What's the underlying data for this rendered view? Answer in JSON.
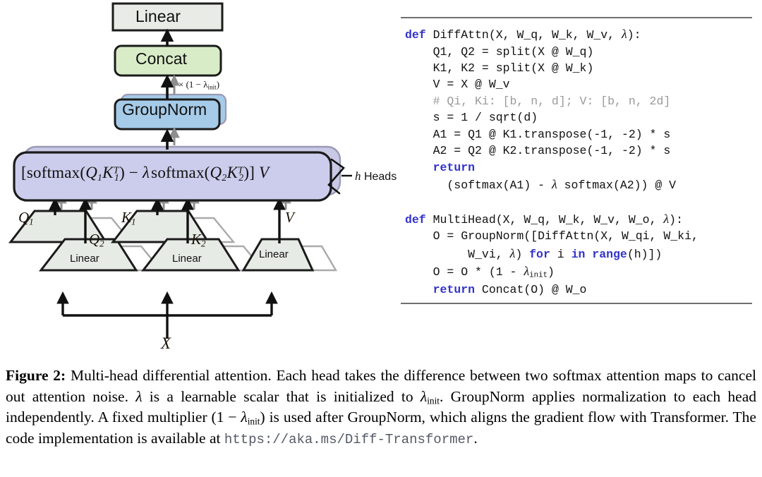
{
  "figure": {
    "id": "Figure 2",
    "diagram": {
      "boxes": {
        "linear_top": "Linear",
        "concat": "Concat",
        "groupnorm": "GroupNorm",
        "trapezoid_q": "Linear",
        "trapezoid_k": "Linear",
        "trapezoid_v": "Linear"
      },
      "annotations": {
        "multiplier": "× (1 − λ",
        "multiplier_sub": "init",
        "multiplier_close": ")",
        "heads": "Heads",
        "heads_var": "h",
        "input": "X"
      },
      "tensor_labels": {
        "q1_base": "Q",
        "q1_sub": "1",
        "q2_base": "Q",
        "q2_sub": "2",
        "k1_base": "K",
        "k1_sub": "1",
        "k2_base": "K",
        "k2_sub": "2",
        "v": "V"
      },
      "formula": {
        "open_bracket": "[",
        "softmax1": "softmax(",
        "q1": "Q",
        "q1sub": "1",
        "k1": "K",
        "k1sub": "1",
        "k1sup": "T",
        "close1": ")",
        "minus": " − ",
        "lambda": "λ",
        "softmax2": "softmax(",
        "q2": "Q",
        "q2sub": "2",
        "k2": "K",
        "k2sub": "2",
        "k2sup": "T",
        "close2": ")",
        "close_bracket": "]",
        "v": "V"
      },
      "colors": {
        "linear_fill": "#e8ebe6",
        "concat_fill": "#d9ecc8",
        "groupnorm_fill": "#a6cbe8",
        "attention_fill": "#ccccec",
        "trapezoid_fill": "#e7ebe5",
        "shadow_stroke": "#aaaaaa",
        "outline": "#1b1b1b"
      }
    },
    "code": {
      "language": "python",
      "lines": [
        {
          "text": "def DiffAttn(X, W_q, W_k, W_v, λ):",
          "keyword": "def"
        },
        {
          "text": "    Q1, Q2 = split(X @ W_q)"
        },
        {
          "text": "    K1, K2 = split(X @ W_k)"
        },
        {
          "text": "    V = X @ W_v"
        },
        {
          "text": "    # Qi, Ki: [b, n, d]; V: [b, n, 2d]",
          "comment": true
        },
        {
          "text": "    s = 1 / sqrt(d)"
        },
        {
          "text": "    A1 = Q1 @ K1.transpose(-1, -2) * s"
        },
        {
          "text": "    A2 = Q2 @ K2.transpose(-1, -2) * s"
        },
        {
          "text": "    return",
          "keyword": "return"
        },
        {
          "text": "      (softmax(A1) - λ softmax(A2)) @ V"
        },
        {
          "text": ""
        },
        {
          "text": "def MultiHead(X, W_q, W_k, W_v, W_o, λ):",
          "keyword": "def"
        },
        {
          "text": "    O = GroupNorm([DiffAttn(X, W_qi, W_ki,"
        },
        {
          "text": "         W_vi, λ) for i in range(h)])",
          "keyword": "for i in range"
        },
        {
          "text": "    O = O * (1 - λ_init)"
        },
        {
          "text": "    return Concat(O) @ W_o",
          "keyword": "return"
        }
      ],
      "keyword_color": "#3333cc",
      "comment_color": "#9a9a9a",
      "rule_color": "#6f6f6f"
    },
    "caption": {
      "label": "Figure 2:",
      "part1": " Multi-head differential attention. Each head takes the difference between two softmax attention maps to cancel out attention noise. ",
      "lambda": "λ",
      "part2": " is a learnable scalar that is initialized to ",
      "lambda_init_base": "λ",
      "lambda_init_sub": "init",
      "part3": ". GroupNorm applies normalization to each head independently. A fixed multiplier ",
      "multiplier_open": "(1 − ",
      "multiplier_lambda": "λ",
      "multiplier_sub": "init",
      "multiplier_close": ")",
      "part4": " is used after GroupNorm, which aligns the gradient flow with Transformer. The code implementation is available at ",
      "url": "https://aka.ms/Diff-Transformer",
      "period": "."
    }
  }
}
